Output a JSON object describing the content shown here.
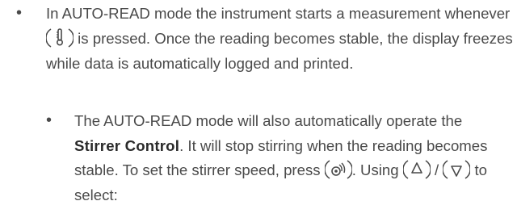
{
  "item1": {
    "before_icon": "In AUTO-READ mode the instrument starts a measurement whenever",
    "icon": "thermometer-probe-key-icon",
    "after_icon": "is pressed.  Once the reading becomes stable, the display freezes while data is automatically logged and printed."
  },
  "item2": {
    "text_a": "The AUTO-READ mode will also automatically operate the",
    "bold": "Stirrer Control",
    "text_b": ". It will stop stirring when the reading becomes stable.  To set the stirrer speed, press",
    "icon_stirrer": "stirrer-key-icon",
    "text_c": ". Using",
    "icon_up": "up-arrow-key-icon",
    "separator": "/",
    "icon_down": "down-arrow-key-icon",
    "text_d": "to select:"
  },
  "colors": {
    "text": "#4a4a4a",
    "bold": "#2a2a2a"
  }
}
